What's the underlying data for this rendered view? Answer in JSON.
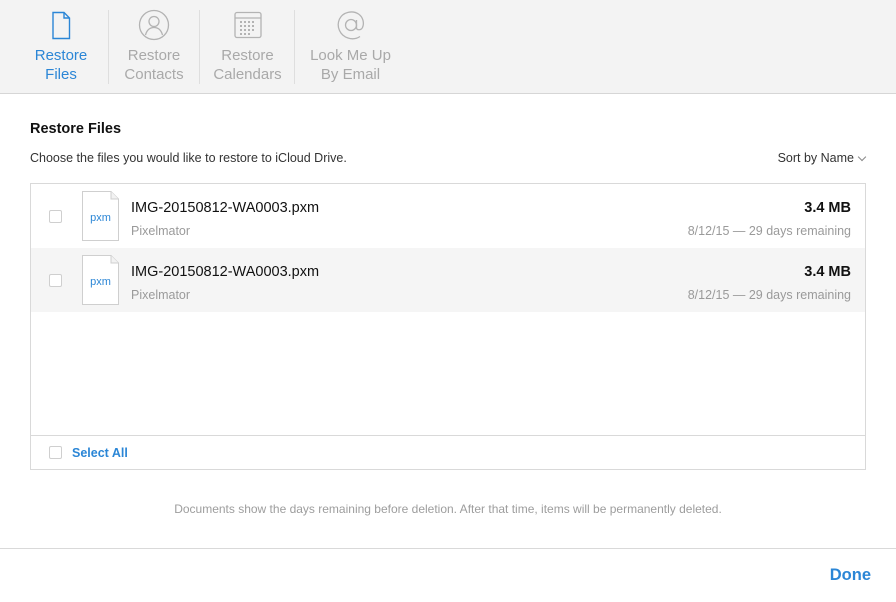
{
  "tabs": [
    {
      "label": "Restore\nFiles",
      "icon": "document-icon",
      "active": true
    },
    {
      "label": "Restore\nContacts",
      "icon": "contact-icon",
      "active": false
    },
    {
      "label": "Restore\nCalendars",
      "icon": "calendar-icon",
      "active": false
    },
    {
      "label": "Look Me Up\nBy Email",
      "icon": "at-sign-icon",
      "active": false
    }
  ],
  "section": {
    "title": "Restore Files",
    "subtitle": "Choose the files you would like to restore to iCloud Drive.",
    "sort_label": "Sort by Name"
  },
  "files": [
    {
      "icon_text": "pxm",
      "name": "IMG-20150812-WA0003.pxm",
      "app": "Pixelmator",
      "size": "3.4 MB",
      "meta": "8/12/15 — 29 days remaining"
    },
    {
      "icon_text": "pxm",
      "name": "IMG-20150812-WA0003.pxm",
      "app": "Pixelmator",
      "size": "3.4 MB",
      "meta": "8/12/15 — 29 days remaining"
    }
  ],
  "select_all_label": "Select All",
  "footnote": "Documents show the days remaining before deletion. After that time, items will be permanently deleted.",
  "done_label": "Done",
  "colors": {
    "accent": "#2b86d6",
    "inactive": "#a9a9a9",
    "toolbar_bg": "#f3f3f3"
  }
}
